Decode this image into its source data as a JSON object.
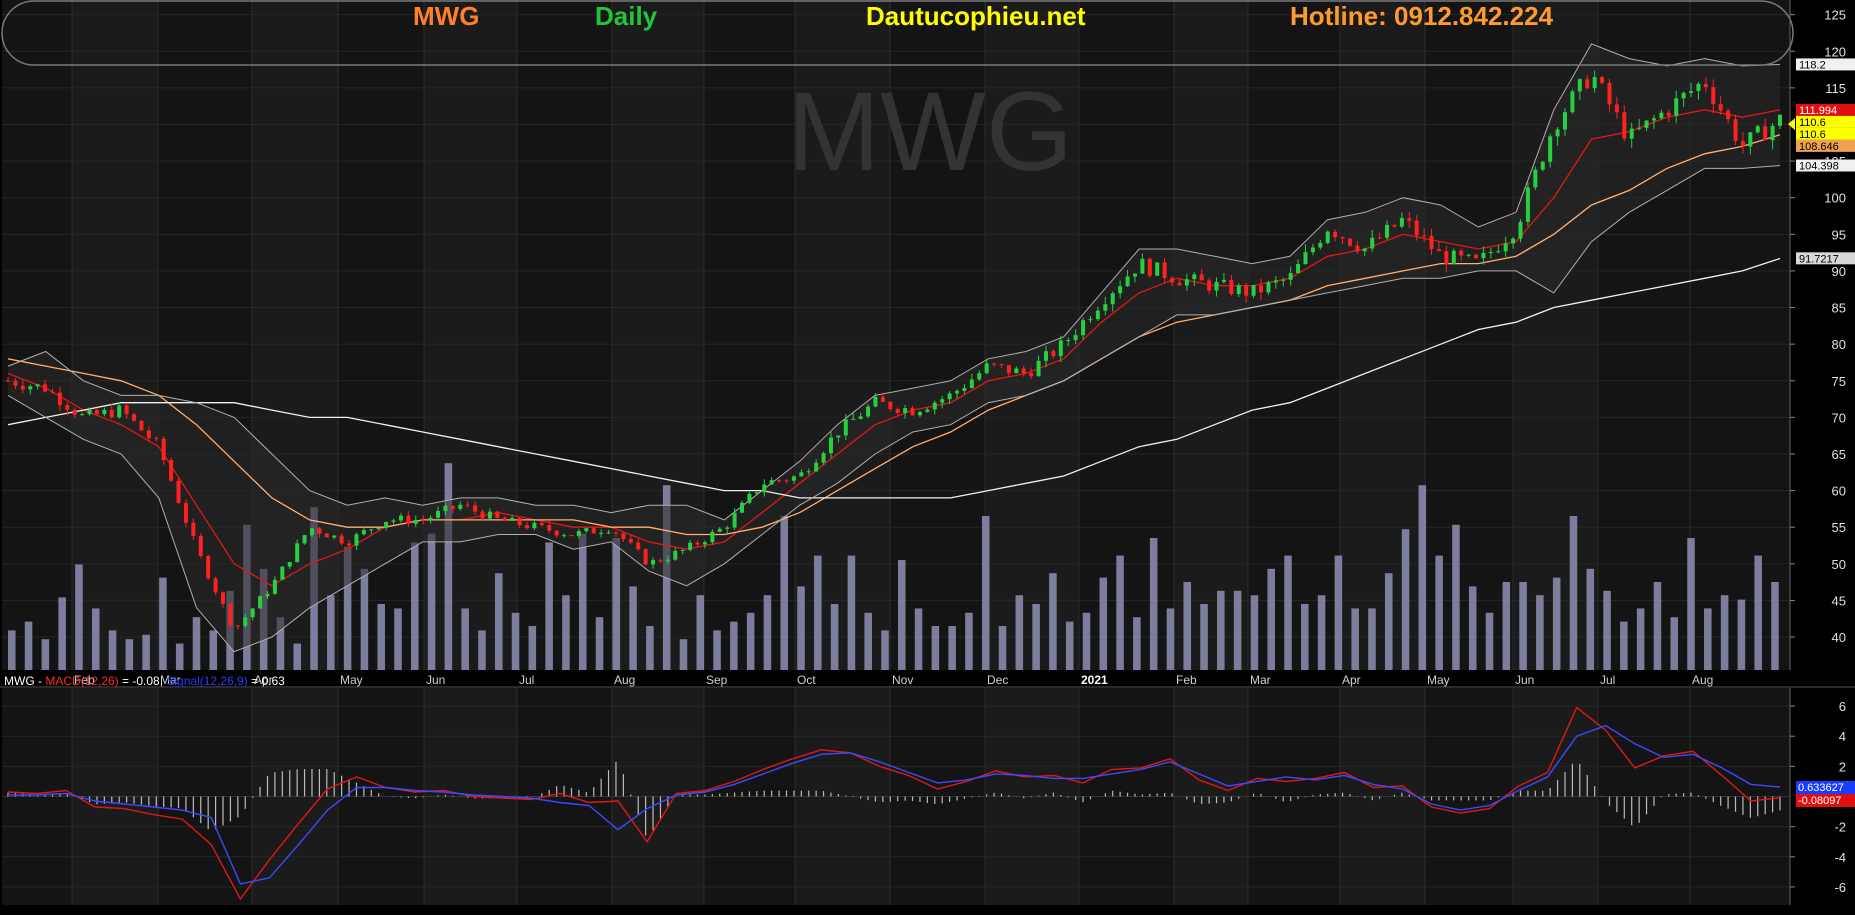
{
  "header": {
    "symbol": "MWG",
    "timeframe": "Daily",
    "site": "Dautucophieu.net",
    "hotline": "Hotline: 0912.842.224",
    "colors": {
      "symbol": "#ff7f2a",
      "timeframe": "#22c43a",
      "site": "#ffff00",
      "hotline": "#ff9b2a"
    }
  },
  "watermark": "MWG",
  "legend": {
    "symbol": "MWG",
    "dash": " - ",
    "macd_label": "MACD(12,26)",
    "macd_value": " = -0.08, ",
    "signal_label": "Signal(12,26,9)",
    "signal_value": " = 0.63"
  },
  "chart_data": [
    {
      "type": "candlestick",
      "instrument": "MWG",
      "interval": "daily",
      "x_tick_labels": [
        "Feb",
        "Mar",
        "Apr",
        "May",
        "Jun",
        "Jul",
        "Aug",
        "Sep",
        "Oct",
        "Nov",
        "Dec",
        "2021",
        "Feb",
        "Mar",
        "Apr",
        "May",
        "Jun",
        "Jul",
        "Aug"
      ],
      "y_ticks": [
        40,
        45,
        50,
        55,
        60,
        65,
        70,
        75,
        80,
        85,
        90,
        95,
        100,
        105,
        110,
        115,
        120,
        125
      ],
      "ylim": [
        35.5,
        127
      ],
      "grid": true,
      "price_labels": [
        {
          "text": "118.2",
          "value": 118.2,
          "bg": "#f0f0f0",
          "fg": "#000000"
        },
        {
          "text": "111.994",
          "value": 111.994,
          "bg": "#e01010",
          "fg": "#ffffff"
        },
        {
          "text": "110.6",
          "value": 110.6,
          "bg": "#ffff00",
          "fg": "#000000"
        },
        {
          "text": "110.6",
          "value": 110.6,
          "bg": "#ffff00",
          "fg": "#000000"
        },
        {
          "text": "108.646",
          "value": 108.646,
          "bg": "#f0a050",
          "fg": "#000000"
        },
        {
          "text": "104.398",
          "value": 104.398,
          "bg": "#f0f0f0",
          "fg": "#000000"
        },
        {
          "text": "91.7217",
          "value": 91.7217,
          "bg": "#d8d8d8",
          "fg": "#000000"
        }
      ],
      "price_path": [
        {
          "x": "Jan",
          "y": 75
        },
        {
          "x": "Feb",
          "y": 74
        },
        {
          "x": "Feb",
          "y": 70
        },
        {
          "x": "Mar",
          "y": 71
        },
        {
          "x": "Mar",
          "y": 66
        },
        {
          "x": "Mar",
          "y": 52
        },
        {
          "x": "Apr",
          "y": 41
        },
        {
          "x": "Apr",
          "y": 47
        },
        {
          "x": "Apr",
          "y": 55
        },
        {
          "x": "May",
          "y": 53
        },
        {
          "x": "May",
          "y": 56
        },
        {
          "x": "Jun",
          "y": 56
        },
        {
          "x": "Jun",
          "y": 58
        },
        {
          "x": "Jun",
          "y": 56
        },
        {
          "x": "Jul",
          "y": 55
        },
        {
          "x": "Jul",
          "y": 54
        },
        {
          "x": "Jul",
          "y": 55
        },
        {
          "x": "Jul",
          "y": 50
        },
        {
          "x": "Aug",
          "y": 52
        },
        {
          "x": "Aug",
          "y": 55
        },
        {
          "x": "Sep",
          "y": 61
        },
        {
          "x": "Sep",
          "y": 62
        },
        {
          "x": "Oct",
          "y": 68
        },
        {
          "x": "Oct",
          "y": 72
        },
        {
          "x": "Nov",
          "y": 71
        },
        {
          "x": "Nov",
          "y": 73
        },
        {
          "x": "Dec",
          "y": 77
        },
        {
          "x": "Dec",
          "y": 76
        },
        {
          "x": "Jan",
          "y": 80
        },
        {
          "x": "Jan",
          "y": 86
        },
        {
          "x": "Feb",
          "y": 91
        },
        {
          "x": "Feb",
          "y": 89
        },
        {
          "x": "Mar",
          "y": 88
        },
        {
          "x": "Mar",
          "y": 87
        },
        {
          "x": "Apr",
          "y": 89
        },
        {
          "x": "Apr",
          "y": 96
        },
        {
          "x": "May",
          "y": 93
        },
        {
          "x": "May",
          "y": 97
        },
        {
          "x": "Jun",
          "y": 92
        },
        {
          "x": "Jun",
          "y": 91
        },
        {
          "x": "Jun",
          "y": 96
        },
        {
          "x": "Jul",
          "y": 110
        },
        {
          "x": "Jul",
          "y": 117
        },
        {
          "x": "Jul",
          "y": 108
        },
        {
          "x": "Aug",
          "y": 112
        },
        {
          "x": "Aug",
          "y": 116
        },
        {
          "x": "Aug",
          "y": 107
        },
        {
          "x": "Aug",
          "y": 110.6
        }
      ],
      "series": [
        {
          "label": "SMA (short)",
          "color": "#e01818",
          "values": [
            76,
            74,
            71,
            69,
            66,
            58,
            50,
            47,
            50,
            52,
            55,
            56,
            56,
            57,
            56,
            55,
            55,
            53,
            52,
            53,
            57,
            61,
            65,
            69,
            71,
            72,
            75,
            76,
            78,
            83,
            87,
            89,
            88,
            88,
            89,
            92,
            93,
            95,
            94,
            93,
            94,
            100,
            108,
            109,
            111,
            112,
            111,
            112
          ]
        },
        {
          "label": "SMA (medium)",
          "color": "#ffb070",
          "values": [
            78,
            77,
            76,
            75,
            73,
            69,
            64,
            59,
            56,
            55,
            55,
            56,
            56,
            56,
            56,
            56,
            55,
            55,
            54,
            54,
            55,
            57,
            60,
            63,
            66,
            68,
            71,
            73,
            75,
            78,
            81,
            83,
            84,
            85,
            86,
            88,
            89,
            90,
            91,
            91,
            92,
            95,
            99,
            101,
            104,
            106,
            107,
            108.6
          ]
        },
        {
          "label": "SMA (long)",
          "color": "#f0f0f0",
          "values": [
            69,
            70,
            71,
            72,
            72,
            72,
            72,
            71,
            70,
            70,
            69,
            68,
            67,
            66,
            65,
            64,
            63,
            62,
            61,
            60,
            60,
            59,
            59,
            59,
            59,
            59,
            60,
            61,
            62,
            64,
            66,
            67,
            69,
            71,
            72,
            74,
            76,
            78,
            80,
            82,
            83,
            85,
            86,
            87,
            88,
            89,
            90,
            91.7
          ]
        },
        {
          "label": "Bollinger upper",
          "color": "#b0b0b0",
          "values": [
            77,
            79,
            75,
            73,
            73,
            72,
            70,
            65,
            60,
            58,
            59,
            58,
            59,
            59,
            58,
            58,
            57,
            58,
            58,
            56,
            60,
            64,
            69,
            73,
            74,
            75,
            78,
            79,
            81,
            87,
            93,
            93,
            92,
            91,
            92,
            97,
            98,
            100,
            99,
            96,
            98,
            112,
            121,
            119,
            118,
            119,
            118,
            118.2
          ]
        },
        {
          "label": "Bollinger lower",
          "color": "#b0b0b0",
          "values": [
            73,
            70,
            67,
            65,
            59,
            44,
            38,
            40,
            44,
            47,
            50,
            53,
            53,
            54,
            54,
            52,
            53,
            49,
            47,
            50,
            54,
            58,
            61,
            65,
            68,
            69,
            72,
            73,
            75,
            78,
            81,
            84,
            84,
            85,
            86,
            87,
            88,
            89,
            89,
            90,
            90,
            87,
            94,
            98,
            101,
            104,
            104,
            104.4
          ]
        }
      ]
    },
    {
      "type": "bar",
      "title": "",
      "description_of_panel": "",
      "values": [
        18,
        22,
        14,
        33,
        48,
        28,
        18,
        14,
        16,
        42,
        12,
        24,
        18,
        36,
        66,
        46,
        24,
        12,
        74,
        34,
        56,
        46,
        30,
        28,
        58,
        62,
        94,
        28,
        18,
        44,
        26,
        20,
        58,
        34,
        62,
        24,
        60,
        38,
        20,
        84,
        14,
        34,
        18,
        22,
        26,
        34,
        70,
        38,
        52,
        30,
        52,
        26,
        18,
        50,
        28,
        20,
        20,
        26,
        70,
        20,
        34,
        30,
        44,
        22,
        26,
        42,
        52,
        24,
        60,
        28,
        40,
        30,
        36,
        36,
        34,
        46,
        52,
        30,
        34,
        52,
        28,
        28,
        44,
        64,
        84,
        52,
        66,
        38,
        26,
        40,
        40,
        34,
        42,
        70,
        46,
        36,
        22,
        28,
        40,
        24,
        60,
        28,
        34,
        32,
        52,
        40
      ],
      "color": "#8e8eb4"
    },
    {
      "type": "line",
      "title": "",
      "y_ticks": [
        -6,
        -4,
        -2,
        2,
        4,
        6
      ],
      "ylim": [
        -7.2,
        7.2
      ],
      "series": [
        {
          "label": "MACD(12,26)",
          "color": "#e01818",
          "values": [
            0.3,
            0.2,
            0.4,
            -0.7,
            -0.8,
            -1.2,
            -1.5,
            -3.2,
            -6.8,
            -4.2,
            -1.8,
            0.5,
            1.3,
            0.6,
            0.3,
            0.4,
            0.0,
            -0.1,
            -0.2,
            0.2,
            -0.4,
            -0.3,
            -3.0,
            0.2,
            0.4,
            1.0,
            1.8,
            2.5,
            3.1,
            2.9,
            2.0,
            1.4,
            0.5,
            1.0,
            1.7,
            1.3,
            1.4,
            0.9,
            1.8,
            1.9,
            2.5,
            1.1,
            0.4,
            1.2,
            1.0,
            1.2,
            1.6,
            0.6,
            0.7,
            -0.7,
            -1.1,
            -0.8,
            0.7,
            1.6,
            5.9,
            4.4,
            1.9,
            2.7,
            3.0,
            1.4,
            -0.3,
            -0.08
          ]
        },
        {
          "label": "Signal(12,26,9)",
          "color": "#3a4bff",
          "values": [
            0.1,
            0.1,
            0.2,
            -0.3,
            -0.5,
            -0.7,
            -0.9,
            -1.4,
            -5.8,
            -5.4,
            -3.2,
            -0.9,
            0.6,
            0.6,
            0.4,
            0.3,
            0.1,
            0.0,
            -0.1,
            -0.4,
            -0.6,
            -2.2,
            -0.8,
            0.1,
            0.3,
            0.8,
            1.5,
            2.2,
            2.8,
            2.9,
            2.3,
            1.6,
            0.9,
            1.1,
            1.5,
            1.4,
            1.2,
            1.2,
            1.5,
            1.8,
            2.3,
            1.5,
            0.7,
            1.0,
            1.3,
            1.1,
            1.4,
            0.8,
            0.5,
            -0.5,
            -0.9,
            -0.6,
            0.4,
            1.3,
            4.0,
            4.7,
            3.5,
            2.6,
            2.8,
            1.9,
            0.8,
            0.63
          ]
        }
      ],
      "histogram_color": "#bbbbbb",
      "value_labels": [
        {
          "text": "0.633627",
          "value": 0.63,
          "bg": "#1a3cff",
          "fg": "#ffffff"
        },
        {
          "text": "-0.08097",
          "value": -0.08,
          "bg": "#e01010",
          "fg": "#ffffff"
        }
      ]
    }
  ]
}
